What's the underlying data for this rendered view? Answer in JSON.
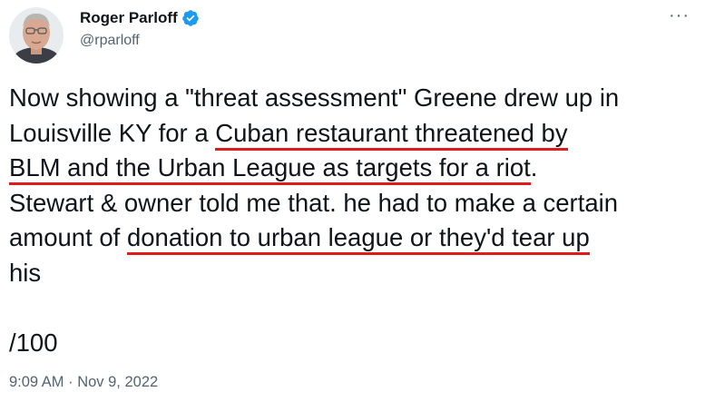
{
  "author": {
    "display_name": "Roger Parloff",
    "handle": "@rparloff",
    "verified_icon": "verified-badge-icon",
    "avatar_icon": "avatar-photo"
  },
  "menu": {
    "more_label": "···"
  },
  "tweet": {
    "l1": "Now showing a \"threat assessment\" Greene drew up in",
    "l2a": "Louisville KY for a ",
    "l2b": "Cuban restaurant threatened by",
    "l3a": "BLM and the Urban League as targets for a riot",
    "l3b": ".",
    "l4": "Stewart & owner told me that. he had to make a certain",
    "l5a": "amount of ",
    "l5b": "donation to urban league or they'd tear up",
    "l6": "his",
    "l8": "/100"
  },
  "timestamp": "9:09 AM · Nov 9, 2022",
  "colors": {
    "verified": "#1d9bf0",
    "underline": "#e01b1b",
    "secondary_text": "#536471"
  }
}
